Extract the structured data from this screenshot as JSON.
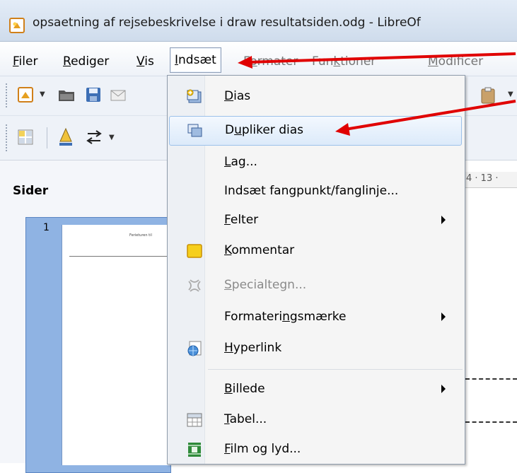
{
  "window": {
    "title": "opsaetning af rejsebeskrivelse i draw resultatsiden.odg - LibreOf",
    "app_icon": "libreoffice-draw-icon"
  },
  "menubar": {
    "items": [
      {
        "label": "Filer"
      },
      {
        "label": "Rediger"
      },
      {
        "label": "Vis"
      },
      {
        "label": "Indsæt"
      },
      {
        "label": "Formater"
      },
      {
        "label": "Funktioner"
      },
      {
        "label": "Modificer"
      }
    ]
  },
  "sidepanel": {
    "title": "Sider",
    "slide_number": "1",
    "slide_thumb_title": "Ferieturen til"
  },
  "ruler": {
    "text": "4 · 13 ·"
  },
  "dropdown": {
    "items": [
      {
        "label": "Dias",
        "icon": "new-slide-icon"
      },
      {
        "label": "Dupliker dias",
        "icon": "duplicate-slide-icon",
        "highlighted": true
      },
      {
        "label": "Lag..."
      },
      {
        "label": "Indsæt fangpunkt/fanglinje..."
      },
      {
        "label": "Felter",
        "submenu": true
      },
      {
        "label": "Kommentar",
        "icon": "comment-icon"
      },
      {
        "label": "Specialtegn...",
        "icon": "special-character-icon",
        "disabled": true
      },
      {
        "label": "Formateringsmærke",
        "submenu": true
      },
      {
        "label": "Hyperlink",
        "icon": "hyperlink-icon"
      },
      {
        "label": "Billede",
        "submenu": true
      },
      {
        "label": "Tabel...",
        "icon": "table-icon"
      },
      {
        "label": "Film og lyd...",
        "icon": "film-sound-icon"
      }
    ]
  },
  "colors": {
    "annotation_arrow": "#e00000",
    "highlight_border": "#9cc1ea"
  }
}
